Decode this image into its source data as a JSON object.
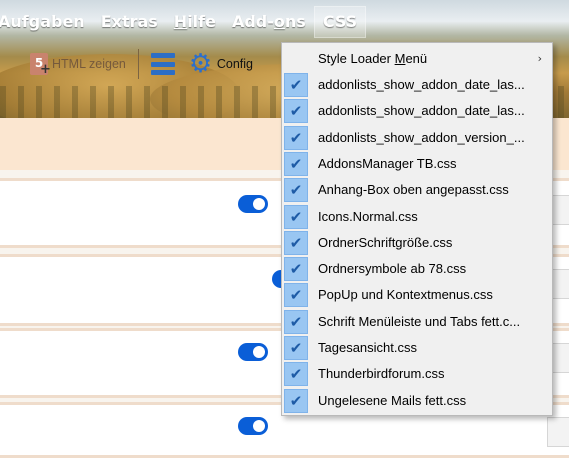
{
  "menubar": {
    "items": [
      {
        "label": "Aufgaben"
      },
      {
        "label": "Extras"
      },
      {
        "label_pre": "",
        "label_u": "H",
        "label_post": "ilfe"
      },
      {
        "label_pre": "Add-",
        "label_u": "o",
        "label_post": "ns"
      },
      {
        "label": "CSS"
      }
    ]
  },
  "toolbar": {
    "html_button_label": "HTML zeigen",
    "config_label": "Config"
  },
  "dropdown": {
    "header": {
      "label_pre": "Style Loader ",
      "label_u": "M",
      "label_post": "enü"
    },
    "items": [
      "addonlists_show_addon_date_las...",
      "addonlists_show_addon_date_las...",
      "addonlists_show_addon_version_...",
      "AddonsManager TB.css",
      "Anhang-Box oben angepasst.css",
      "Icons.Normal.css",
      "OrdnerSchriftgröße.css",
      "Ordnersymbole ab 78.css",
      "PopUp und Kontextmenus.css",
      "Schrift Menüleiste und Tabs fett.c...",
      "Tagesansicht.css",
      "Thunderbirdforum.css",
      "Ungelesene Mails fett.css"
    ]
  },
  "colors": {
    "accent_toggle": "#0a5ed7",
    "check_bg": "#99c6f2",
    "menu_bg": "#f0f0f0"
  },
  "icons": {
    "html_button": "html5-icon",
    "list_button": "list-icon",
    "config_button": "gear-icon",
    "checkmark": "checkmark-icon",
    "submenu": "chevron-right-icon"
  }
}
